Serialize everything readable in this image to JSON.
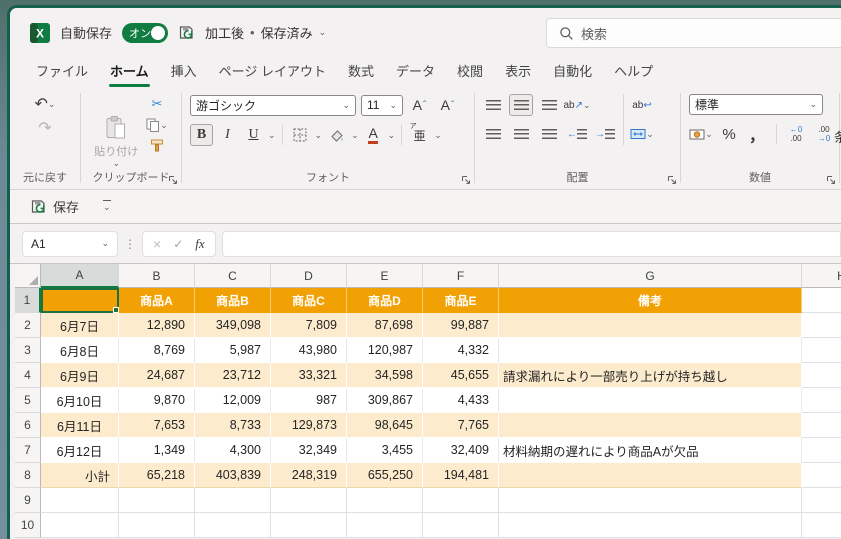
{
  "titlebar": {
    "autosave_label": "自動保存",
    "autosave_state": "オン",
    "filename": "加工後",
    "separator_dot": "•",
    "file_status": "保存済み"
  },
  "search": {
    "placeholder": "検索"
  },
  "tabs": {
    "active_key": "home",
    "items": [
      {
        "key": "file",
        "label": "ファイル"
      },
      {
        "key": "home",
        "label": "ホーム"
      },
      {
        "key": "insert",
        "label": "挿入"
      },
      {
        "key": "page-layout",
        "label": "ページ レイアウト"
      },
      {
        "key": "formulas",
        "label": "数式"
      },
      {
        "key": "data",
        "label": "データ"
      },
      {
        "key": "review",
        "label": "校閲"
      },
      {
        "key": "view",
        "label": "表示"
      },
      {
        "key": "automate",
        "label": "自動化"
      },
      {
        "key": "help",
        "label": "ヘルプ"
      }
    ]
  },
  "ribbon": {
    "undo": {
      "label": "元に戻す"
    },
    "clipboard": {
      "label": "クリップボード",
      "paste_label": "貼り付け"
    },
    "font": {
      "label": "フォント",
      "font_name": "游ゴシック",
      "font_size": "11"
    },
    "alignment": {
      "label": "配置"
    },
    "number": {
      "label": "数値",
      "format_name": "標準"
    },
    "next_group_fragment": "条"
  },
  "qat": {
    "save_label": "保存"
  },
  "formula_bar": {
    "name_box_value": "A1",
    "cancel_glyph": "×",
    "enter_glyph": "✓",
    "fx_label": "fx",
    "formula_value": ""
  },
  "icons": {
    "chevron_down": "⌄",
    "undo": "↶",
    "redo": "↷",
    "cut": "✂",
    "dots_vertical": "⋮",
    "bold": "B",
    "italic": "I",
    "underline": "U",
    "font_color_letter": "A",
    "letter_a": "A",
    "caret_up": "ˆ",
    "caret_down": "ˇ",
    "phonetic_main": "亜",
    "phonetic_ruby": "ア",
    "orientation_text": "ab",
    "orientation_arrow": "↗",
    "wrap_text": "ab",
    "wrap_arrow": "↩",
    "indent_dec_arrow": "←",
    "indent_inc_arrow": "→",
    "percent": "%",
    "comma": "，",
    "increase_decimal_top": "←0",
    "increase_decimal_bottom": ".00",
    "decrease_decimal_top": ".00",
    "decrease_decimal_bottom": "→0"
  },
  "sheet": {
    "column_headers": [
      "A",
      "B",
      "C",
      "D",
      "E",
      "F",
      "G",
      "H"
    ],
    "selected_column": "A",
    "selected_row": "1",
    "active_cell": "A1",
    "row_numbers": [
      "1",
      "2",
      "3",
      "4",
      "5",
      "6",
      "7",
      "8",
      "9",
      "10"
    ],
    "table": {
      "product_headers": [
        "商品A",
        "商品B",
        "商品C",
        "商品D",
        "商品E"
      ],
      "note_header": "備考",
      "rows": [
        {
          "date": "6月7日",
          "values": [
            "12,890",
            "349,098",
            "7,809",
            "87,698",
            "99,887"
          ],
          "note": ""
        },
        {
          "date": "6月8日",
          "values": [
            "8,769",
            "5,987",
            "43,980",
            "120,987",
            "4,332"
          ],
          "note": ""
        },
        {
          "date": "6月9日",
          "values": [
            "24,687",
            "23,712",
            "33,321",
            "34,598",
            "45,655"
          ],
          "note": "請求漏れにより一部売り上げが持ち越し"
        },
        {
          "date": "6月10日",
          "values": [
            "9,870",
            "12,009",
            "987",
            "309,867",
            "4,433"
          ],
          "note": ""
        },
        {
          "date": "6月11日",
          "values": [
            "7,653",
            "8,733",
            "129,873",
            "98,645",
            "7,765"
          ],
          "note": ""
        },
        {
          "date": "6月12日",
          "values": [
            "1,349",
            "4,300",
            "32,349",
            "3,455",
            "32,409"
          ],
          "note": "材料納期の遅れにより商品Aが欠品"
        },
        {
          "date": "小計",
          "values": [
            "65,218",
            "403,839",
            "248,319",
            "655,250",
            "194,481"
          ],
          "note": "",
          "is_total": true
        }
      ]
    },
    "colors": {
      "table_header_fill": "#F2A104",
      "band_fill": "#FDEBCD",
      "selection_green": "#1E6F42",
      "accent_green": "#107C41",
      "selected_header_fill": "#D9DBDA"
    }
  }
}
